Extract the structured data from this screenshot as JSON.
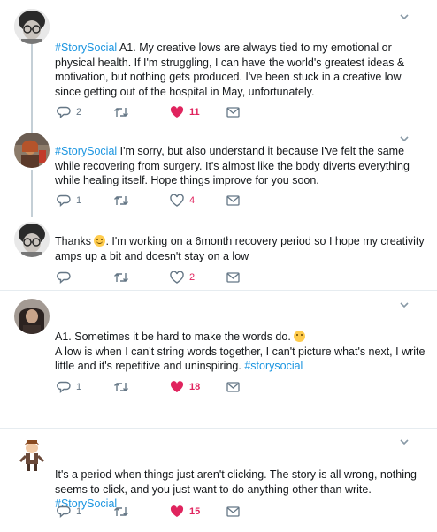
{
  "colors": {
    "accent": "#1b95e0",
    "like": "#e0245e",
    "muted": "#657786",
    "thread": "#c4cfd6"
  },
  "tweets": [
    {
      "hashtag": "#StorySocial",
      "text": " A1. My creative lows are always tied to my emotional or physical health. If I'm struggling, I can have the world's greatest ideas & motivation, but nothing gets produced. I've been stuck in a creative low since getting out of the hospital in May, unfortunately.",
      "replies": "2",
      "retweets": "",
      "likes": "11"
    },
    {
      "hashtag": "#StorySocial",
      "text": " I'm sorry, but also understand it because I've felt the same while recovering from surgery. It's almost like the body diverts everything while healing itself. Hope things improve for you soon.",
      "replies": "1",
      "retweets": "",
      "likes": "4"
    },
    {
      "text_before": "Thanks ",
      "text_after": ". I'm working on a 6month recovery period so I hope my creativity amps up a bit and doesn't stay on a low",
      "replies": "",
      "retweets": "",
      "likes": "2"
    },
    {
      "line1": "A1. Sometimes it be hard to make the words do. ",
      "line2": "A low is when I can't string words together, I can't picture what's next, I write little and it's repetitive and uninspiring. ",
      "hashtag": "#storysocial",
      "replies": "1",
      "retweets": "",
      "likes": "18"
    },
    {
      "text": "It's a period when things just aren't clicking. The story is all wrong, nothing seems to click, and you just want to do anything other than write. ",
      "hashtag": "#StorySocial",
      "replies": "1",
      "retweets": "",
      "likes": "15"
    }
  ],
  "icons": {
    "reply": "reply-icon",
    "retweet": "retweet-icon",
    "like": "heart-icon",
    "dm": "envelope-icon",
    "more": "chevron-down-icon",
    "grin": "grinning-emoji",
    "sweat": "sweat-smile-emoji"
  }
}
